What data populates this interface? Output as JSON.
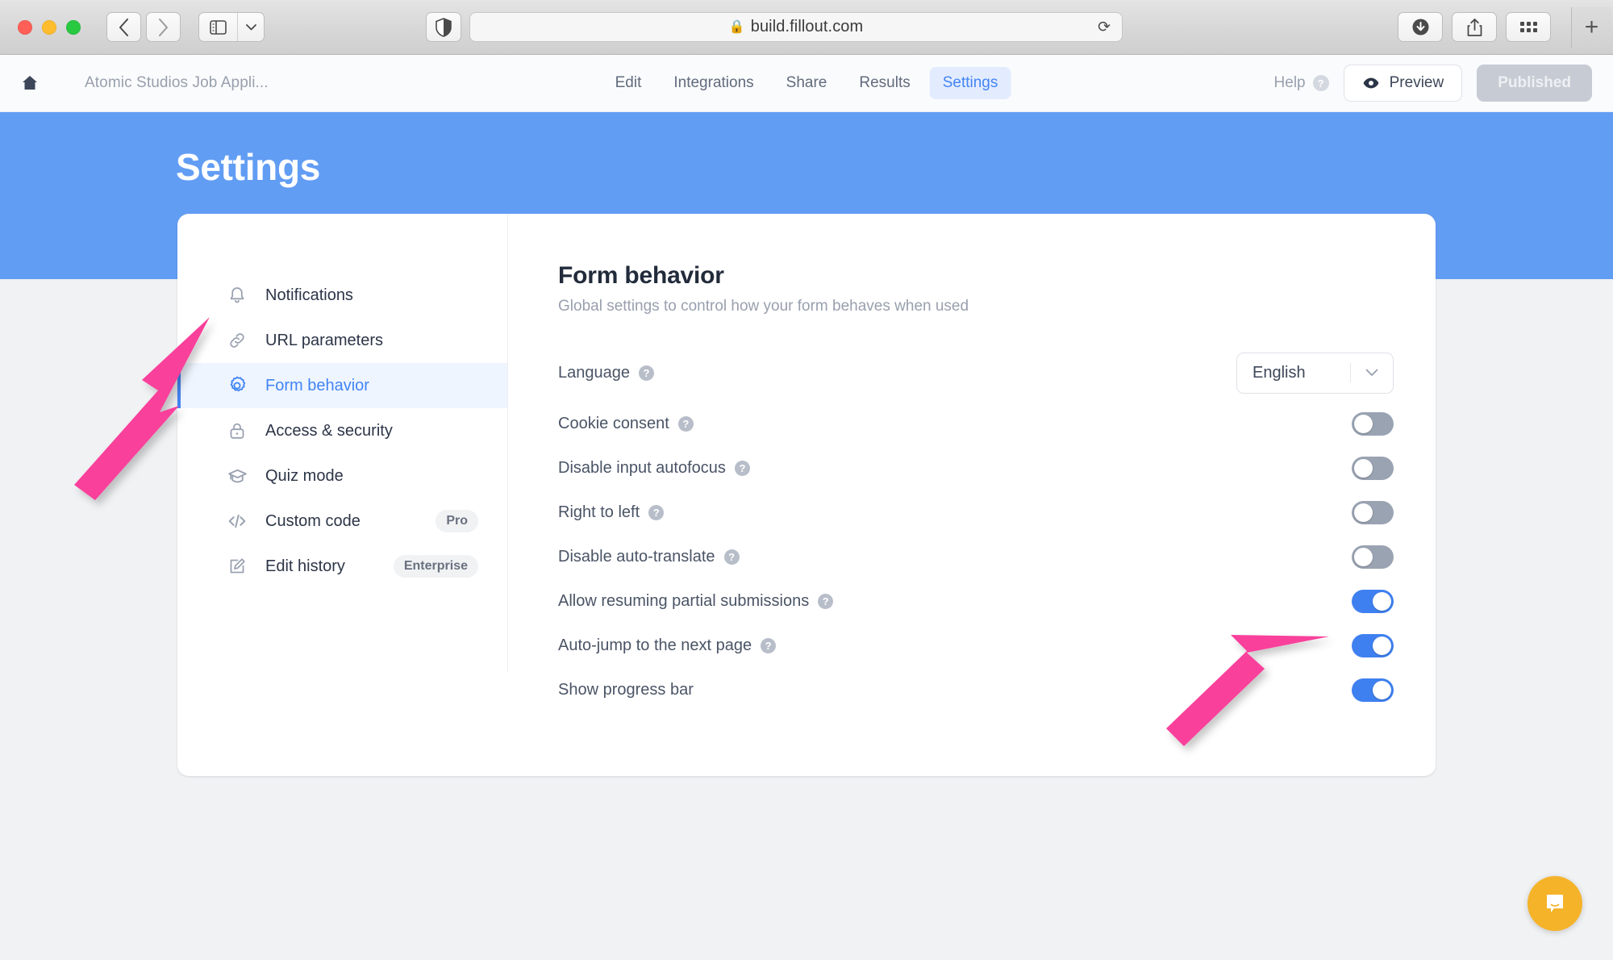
{
  "browser": {
    "url": "build.fillout.com",
    "lock_icon": "lock-icon",
    "reload_icon": "reload-icon",
    "back_icon": "back-chevron-icon",
    "forward_icon": "forward-chevron-icon",
    "sidebar_icon": "sidebar-toggle-icon",
    "shield_icon": "privacy-shield-icon",
    "download_icon": "download-icon",
    "share_icon": "share-icon",
    "tabgrid_icon": "tab-overview-icon",
    "newtab_label": "+"
  },
  "app_header": {
    "home_icon": "home-icon",
    "form_title": "Atomic Studios Job Appli...",
    "tabs": [
      {
        "label": "Edit",
        "active": false
      },
      {
        "label": "Integrations",
        "active": false
      },
      {
        "label": "Share",
        "active": false
      },
      {
        "label": "Results",
        "active": false
      },
      {
        "label": "Settings",
        "active": true
      }
    ],
    "help_label": "Help",
    "help_badge": "?",
    "preview_label": "Preview",
    "published_label": "Published"
  },
  "banner": {
    "title": "Settings",
    "color": "#629df4"
  },
  "settings_nav": {
    "items": [
      {
        "label": "Notifications",
        "icon": "bell-icon",
        "active": false,
        "badge": ""
      },
      {
        "label": "URL parameters",
        "icon": "link-icon",
        "active": false,
        "badge": ""
      },
      {
        "label": "Form behavior",
        "icon": "gear-icon",
        "active": true,
        "badge": ""
      },
      {
        "label": "Access & security",
        "icon": "lock-icon",
        "active": false,
        "badge": ""
      },
      {
        "label": "Quiz mode",
        "icon": "graduation-icon",
        "active": false,
        "badge": ""
      },
      {
        "label": "Custom code",
        "icon": "code-icon",
        "active": false,
        "badge": "Pro"
      },
      {
        "label": "Edit history",
        "icon": "edit-pencil-icon",
        "active": false,
        "badge": "Enterprise"
      }
    ]
  },
  "panel": {
    "title": "Form behavior",
    "subtitle": "Global settings to control how your form behaves when used",
    "language_row": {
      "label": "Language",
      "hint": "?",
      "selected": "English",
      "caret_icon": "chevron-down-icon"
    },
    "toggles": [
      {
        "label": "Cookie consent",
        "hint": "?",
        "on": false
      },
      {
        "label": "Disable input autofocus",
        "hint": "?",
        "on": false
      },
      {
        "label": "Right to left",
        "hint": "?",
        "on": false
      },
      {
        "label": "Disable auto-translate",
        "hint": "?",
        "on": false
      },
      {
        "label": "Allow resuming partial submissions",
        "hint": "?",
        "on": true
      },
      {
        "label": "Auto-jump to the next page",
        "hint": "?",
        "on": true
      },
      {
        "label": "Show progress bar",
        "hint": "",
        "on": true
      }
    ]
  },
  "annotations": {
    "arrow_color": "#f9419b",
    "arrows": [
      {
        "name": "arrow-pointing-to-form-behavior"
      },
      {
        "name": "arrow-pointing-to-auto-jump-toggle"
      }
    ]
  },
  "intercom": {
    "icon": "chat-bubble-icon",
    "color": "#f5b32a"
  },
  "accent_colors": {
    "primary_blue": "#4285f4",
    "toggle_on": "#3f80f0",
    "toggle_off": "#9aa3b2",
    "banner_blue": "#629df4"
  }
}
